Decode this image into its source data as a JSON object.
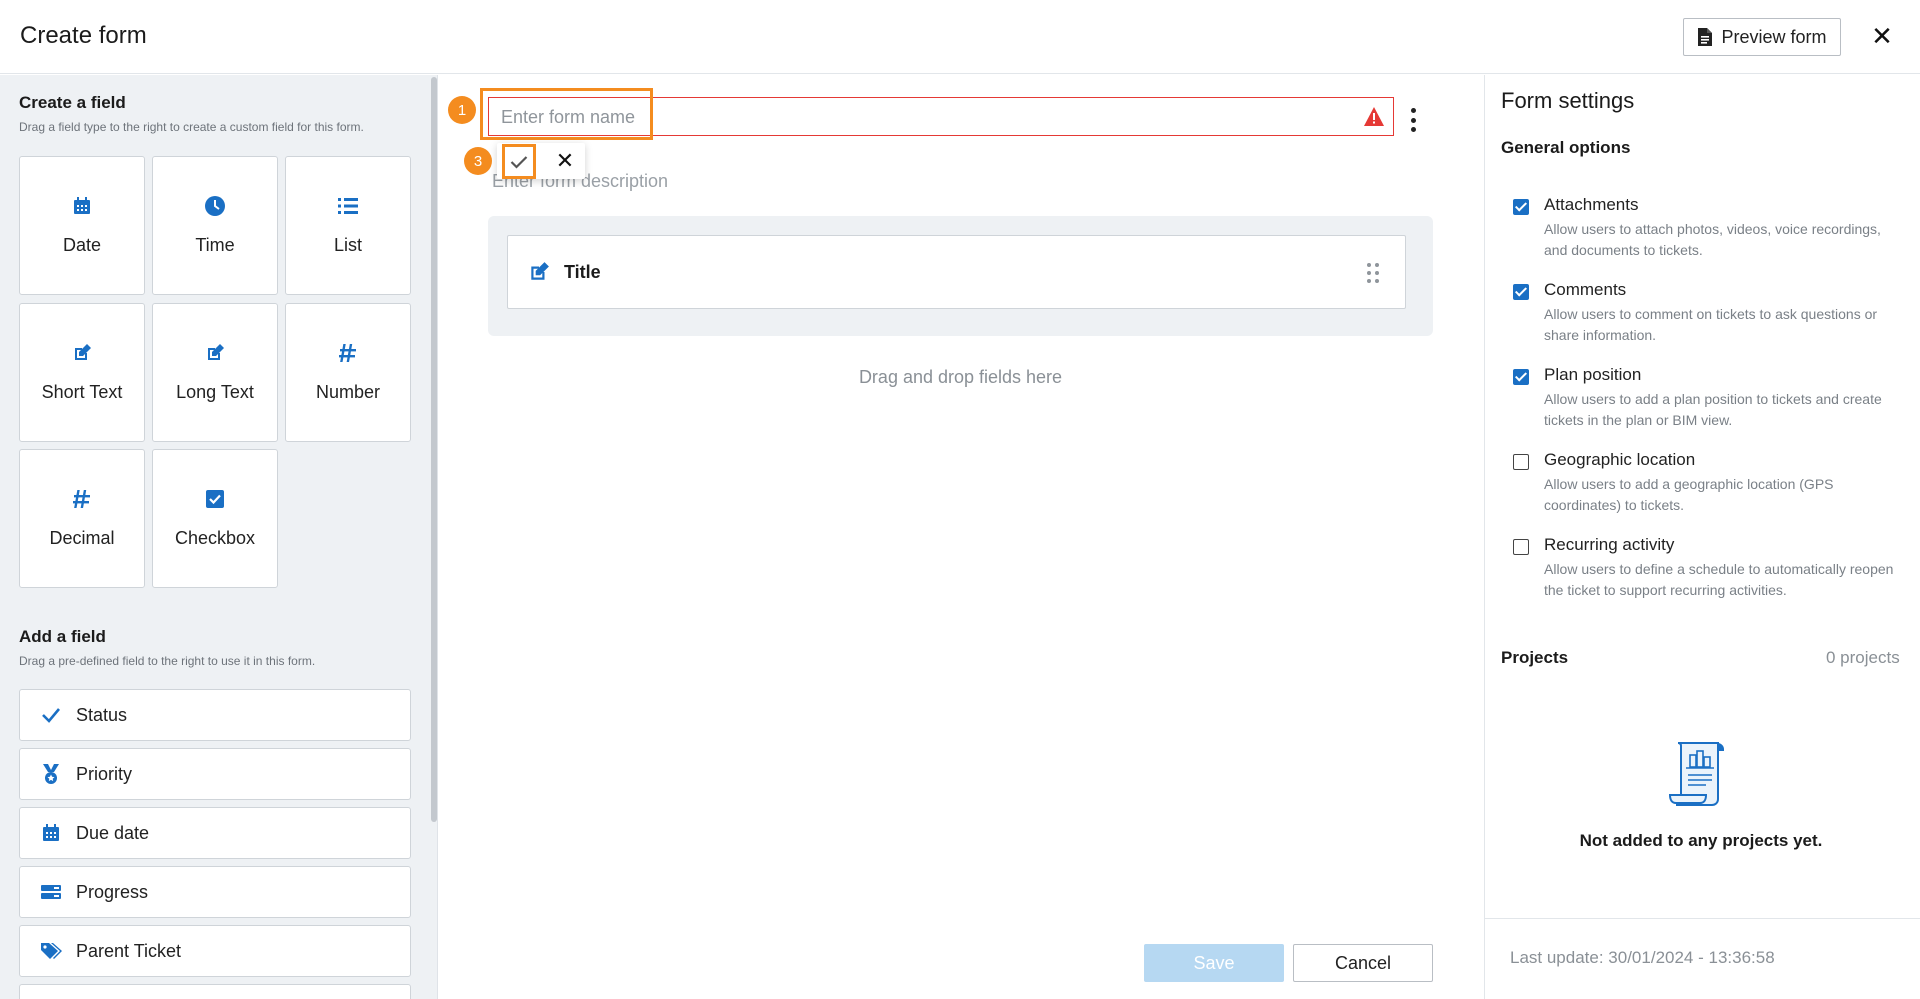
{
  "header": {
    "title": "Create form",
    "preview_label": "Preview form"
  },
  "left": {
    "create_title": "Create a field",
    "create_desc": "Drag a field type to the right to create a custom field for this form.",
    "field_types": [
      {
        "label": "Date",
        "icon": "calendar-icon"
      },
      {
        "label": "Time",
        "icon": "clock-icon"
      },
      {
        "label": "List",
        "icon": "list-icon"
      },
      {
        "label": "Short Text",
        "icon": "edit-icon"
      },
      {
        "label": "Long Text",
        "icon": "edit-icon"
      },
      {
        "label": "Number",
        "icon": "hash-icon"
      },
      {
        "label": "Decimal",
        "icon": "hash-icon"
      },
      {
        "label": "Checkbox",
        "icon": "checkbox-icon"
      }
    ],
    "add_title": "Add a field",
    "add_desc": "Drag a pre-defined field to the right to use it in this form.",
    "predefined": [
      {
        "label": "Status",
        "icon": "check-icon"
      },
      {
        "label": "Priority",
        "icon": "medal-icon"
      },
      {
        "label": "Due date",
        "icon": "calendar-icon"
      },
      {
        "label": "Progress",
        "icon": "progress-icon"
      },
      {
        "label": "Parent Ticket",
        "icon": "tag-icon"
      }
    ]
  },
  "center": {
    "name_placeholder": "Enter form name",
    "desc_placeholder": "Enter form description",
    "badge_1": "1",
    "badge_3": "3",
    "title_field": "Title",
    "drop_hint": "Drag and drop fields here",
    "save_label": "Save",
    "cancel_label": "Cancel"
  },
  "right": {
    "title": "Form settings",
    "general": "General options",
    "options": [
      {
        "label": "Attachments",
        "desc": "Allow users to attach photos, videos, voice recordings, and documents to tickets.",
        "checked": true
      },
      {
        "label": "Comments",
        "desc": "Allow users to comment on tickets to ask questions or share information.",
        "checked": true
      },
      {
        "label": "Plan position",
        "desc": "Allow users to add a plan position to tickets and create tickets in the plan or BIM view.",
        "checked": true
      },
      {
        "label": "Geographic location",
        "desc": "Allow users to add a geographic location (GPS coordinates) to tickets.",
        "checked": false
      },
      {
        "label": "Recurring activity",
        "desc": "Allow users to define a schedule to automatically reopen the ticket to support recurring activities.",
        "checked": false
      }
    ],
    "projects_label": "Projects",
    "projects_count": "0 projects",
    "projects_empty": "Not added to any projects yet.",
    "last_update": "Last update: 30/01/2024 - 13:36:58"
  },
  "colors": {
    "accent": "#1a6fc4",
    "highlight": "#f48c1f",
    "error": "#e53935"
  }
}
